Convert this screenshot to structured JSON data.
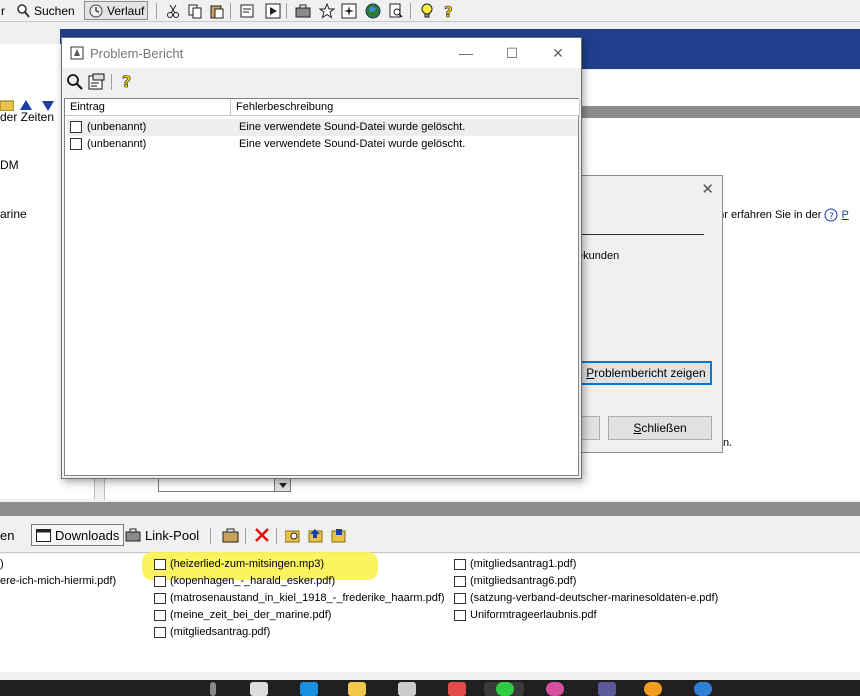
{
  "toolbar": {
    "frag_left": "r",
    "search_label": "Suchen",
    "history_label": "Verlauf"
  },
  "left_panel": {
    "items": [
      "der Zeiten",
      "DM",
      "arine"
    ]
  },
  "bg_dialog": {
    "info_text": "ehr erfahren Sie in der",
    "info_link": "P",
    "seconds_text": "ekunden",
    "show_report_button_prefix": "",
    "show_report_button_underlined": "P",
    "show_report_button_rest": "roblembericht zeigen",
    "close_button_underlined": "S",
    "close_button_rest": "chließen",
    "trailing_text": "n."
  },
  "problem_window": {
    "title": "Problem-Bericht",
    "columns": [
      "Eintrag",
      "Fehlerbeschreibung"
    ],
    "rows": [
      {
        "entry": "(unbenannt)",
        "description": "Eine verwendete Sound-Datei wurde gelöscht."
      },
      {
        "entry": "(unbenannt)",
        "description": "Eine verwendete Sound-Datei wurde gelöscht."
      }
    ]
  },
  "bottom_tabs": {
    "frag_left": "en",
    "downloads": "Downloads",
    "link_pool": "Link-Pool"
  },
  "downloads": {
    "col0": [
      ")",
      "ere-ich-mich-hiermi.pdf)"
    ],
    "col1": [
      "(heizerlied-zum-mitsingen.mp3)",
      "(kopenhagen_-_harald_esker.pdf)",
      "(matrosenaustand_in_kiel_1918_-_frederike_haarm.pdf)",
      "(meine_zeit_bei_der_marine.pdf)",
      "(mitgliedsantrag.pdf)"
    ],
    "col2": [
      "(mitgliedsantrag1.pdf)",
      "(mitgliedsantrag6.pdf)",
      "(satzung-verband-deutscher-marinesoldaten-e.pdf)",
      "Uniformtrageerlaubnis.pdf"
    ]
  },
  "colors": {
    "header_band": "#1f3f8c",
    "highlight": "#f8f34e",
    "taskbar": "#202020"
  }
}
